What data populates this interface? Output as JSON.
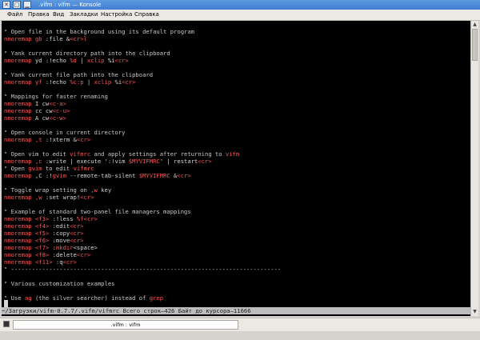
{
  "window": {
    "title": ".vifm : vifm — Konsole",
    "buttons": [
      "✕",
      "□",
      "▁"
    ]
  },
  "menu": [
    "Файл",
    "Правка",
    "Вид",
    "Закладки",
    "Настройка",
    "Справка"
  ],
  "terminal": {
    "lines": [
      [
        [
          "c",
          "\" Open file in the background using its default program"
        ]
      ],
      [
        [
          "n",
          "nnoremap "
        ],
        [
          "r",
          "gb"
        ],
        [
          "t",
          " :file &"
        ],
        [
          "r",
          "<cr>"
        ],
        [
          "r",
          "l"
        ]
      ],
      [],
      [
        [
          "c",
          "\" Yank current directory path into the clipboard"
        ]
      ],
      [
        [
          "n",
          "nnoremap "
        ],
        [
          "t",
          "yd :!echo "
        ],
        [
          "r",
          "%d"
        ],
        [
          "t",
          " | "
        ],
        [
          "r",
          "xclip"
        ],
        [
          "t",
          " %i"
        ],
        [
          "r",
          "<cr>"
        ]
      ],
      [],
      [
        [
          "c",
          "\" Yank current file path into the clipboard"
        ]
      ],
      [
        [
          "n",
          "nnoremap "
        ],
        [
          "r",
          "yf"
        ],
        [
          "t",
          " :!echo "
        ],
        [
          "r",
          "%c:p"
        ],
        [
          "t",
          " | "
        ],
        [
          "r",
          "xclip"
        ],
        [
          "t",
          " %i"
        ],
        [
          "r",
          "<cr>"
        ]
      ],
      [],
      [
        [
          "c",
          "\" Mappings for faster renaming"
        ]
      ],
      [
        [
          "n",
          "nnoremap "
        ],
        [
          "t",
          "I cw"
        ],
        [
          "r",
          "<c-a>"
        ]
      ],
      [
        [
          "n",
          "nnoremap "
        ],
        [
          "t",
          "cc cw"
        ],
        [
          "r",
          "<c-u>"
        ]
      ],
      [
        [
          "n",
          "nnoremap "
        ],
        [
          "t",
          "A cw"
        ],
        [
          "r",
          "<c-w>"
        ]
      ],
      [],
      [
        [
          "c",
          "\" Open console in current directory"
        ]
      ],
      [
        [
          "n",
          "nnoremap "
        ],
        [
          "r",
          ",t"
        ],
        [
          "t",
          " :!xterm &"
        ],
        [
          "r",
          "<cr>"
        ]
      ],
      [],
      [
        [
          "c",
          "\" Open vim to edit "
        ],
        [
          "r",
          "vifmrc"
        ],
        [
          "c",
          " and apply settings after returning to "
        ],
        [
          "r",
          "vifm"
        ]
      ],
      [
        [
          "n",
          "nnoremap "
        ],
        [
          "r",
          ",c"
        ],
        [
          "t",
          " :write | execute ':!vim "
        ],
        [
          "r",
          "$MYVIFMRC"
        ],
        [
          "t",
          "' | restart"
        ],
        [
          "r",
          "<cr>"
        ]
      ],
      [
        [
          "c",
          "\" Open "
        ],
        [
          "r",
          "gvim"
        ],
        [
          "c",
          " to edit "
        ],
        [
          "r",
          "vifmrc"
        ]
      ],
      [
        [
          "n",
          "nnoremap "
        ],
        [
          "t",
          ",C :!"
        ],
        [
          "r",
          "gvim"
        ],
        [
          "t",
          " --remote-tab-silent "
        ],
        [
          "r",
          "$MYVIFMRC"
        ],
        [
          "t",
          " &"
        ],
        [
          "r",
          "<cr>"
        ]
      ],
      [],
      [
        [
          "c",
          "\" Toggle wrap setting on "
        ],
        [
          "r",
          ",w"
        ],
        [
          "c",
          " key"
        ]
      ],
      [
        [
          "n",
          "nnoremap "
        ],
        [
          "r",
          ",w"
        ],
        [
          "t",
          " :set wrap!"
        ],
        [
          "r",
          "<cr>"
        ]
      ],
      [],
      [
        [
          "c",
          "\" Example of standard two-panel file managers mappings"
        ]
      ],
      [
        [
          "n",
          "nnoremap "
        ],
        [
          "r",
          "<f3>"
        ],
        [
          "t",
          " :!less "
        ],
        [
          "r",
          "%f"
        ],
        [
          "r",
          "<cr>"
        ]
      ],
      [
        [
          "n",
          "nnoremap "
        ],
        [
          "r",
          "<f4>"
        ],
        [
          "t",
          " :edit"
        ],
        [
          "r",
          "<cr>"
        ]
      ],
      [
        [
          "n",
          "nnoremap "
        ],
        [
          "r",
          "<f5>"
        ],
        [
          "t",
          " :copy"
        ],
        [
          "r",
          "<cr>"
        ]
      ],
      [
        [
          "n",
          "nnoremap "
        ],
        [
          "r",
          "<f6>"
        ],
        [
          "t",
          " :move"
        ],
        [
          "r",
          "<cr>"
        ]
      ],
      [
        [
          "n",
          "nnoremap "
        ],
        [
          "r",
          "<f7>"
        ],
        [
          "t",
          " :"
        ],
        [
          "r",
          "mkdir"
        ],
        [
          "t",
          "<space>"
        ]
      ],
      [
        [
          "n",
          "nnoremap "
        ],
        [
          "r",
          "<f8>"
        ],
        [
          "t",
          " :delete"
        ],
        [
          "r",
          "<cr>"
        ]
      ],
      [
        [
          "n",
          "nnoremap "
        ],
        [
          "r",
          "<f11>"
        ],
        [
          "t",
          " :q"
        ],
        [
          "r",
          "<cr>"
        ]
      ],
      [
        [
          "c",
          "\" ------------------------------------------------------------------------------"
        ]
      ],
      [],
      [
        [
          "c",
          "\" Various customization examples"
        ]
      ],
      [],
      [
        [
          "c",
          "\" Use "
        ],
        [
          "r",
          "ag"
        ],
        [
          "c",
          " (the silver searcher) instead of "
        ],
        [
          "r",
          "grep"
        ]
      ]
    ],
    "status": "~/Загрузки/vifm-0.7.7/.vifm/vifmrc Всего строк—426 Байт до курсора—11666"
  },
  "tab": {
    "label": ".vifm : vifm"
  }
}
